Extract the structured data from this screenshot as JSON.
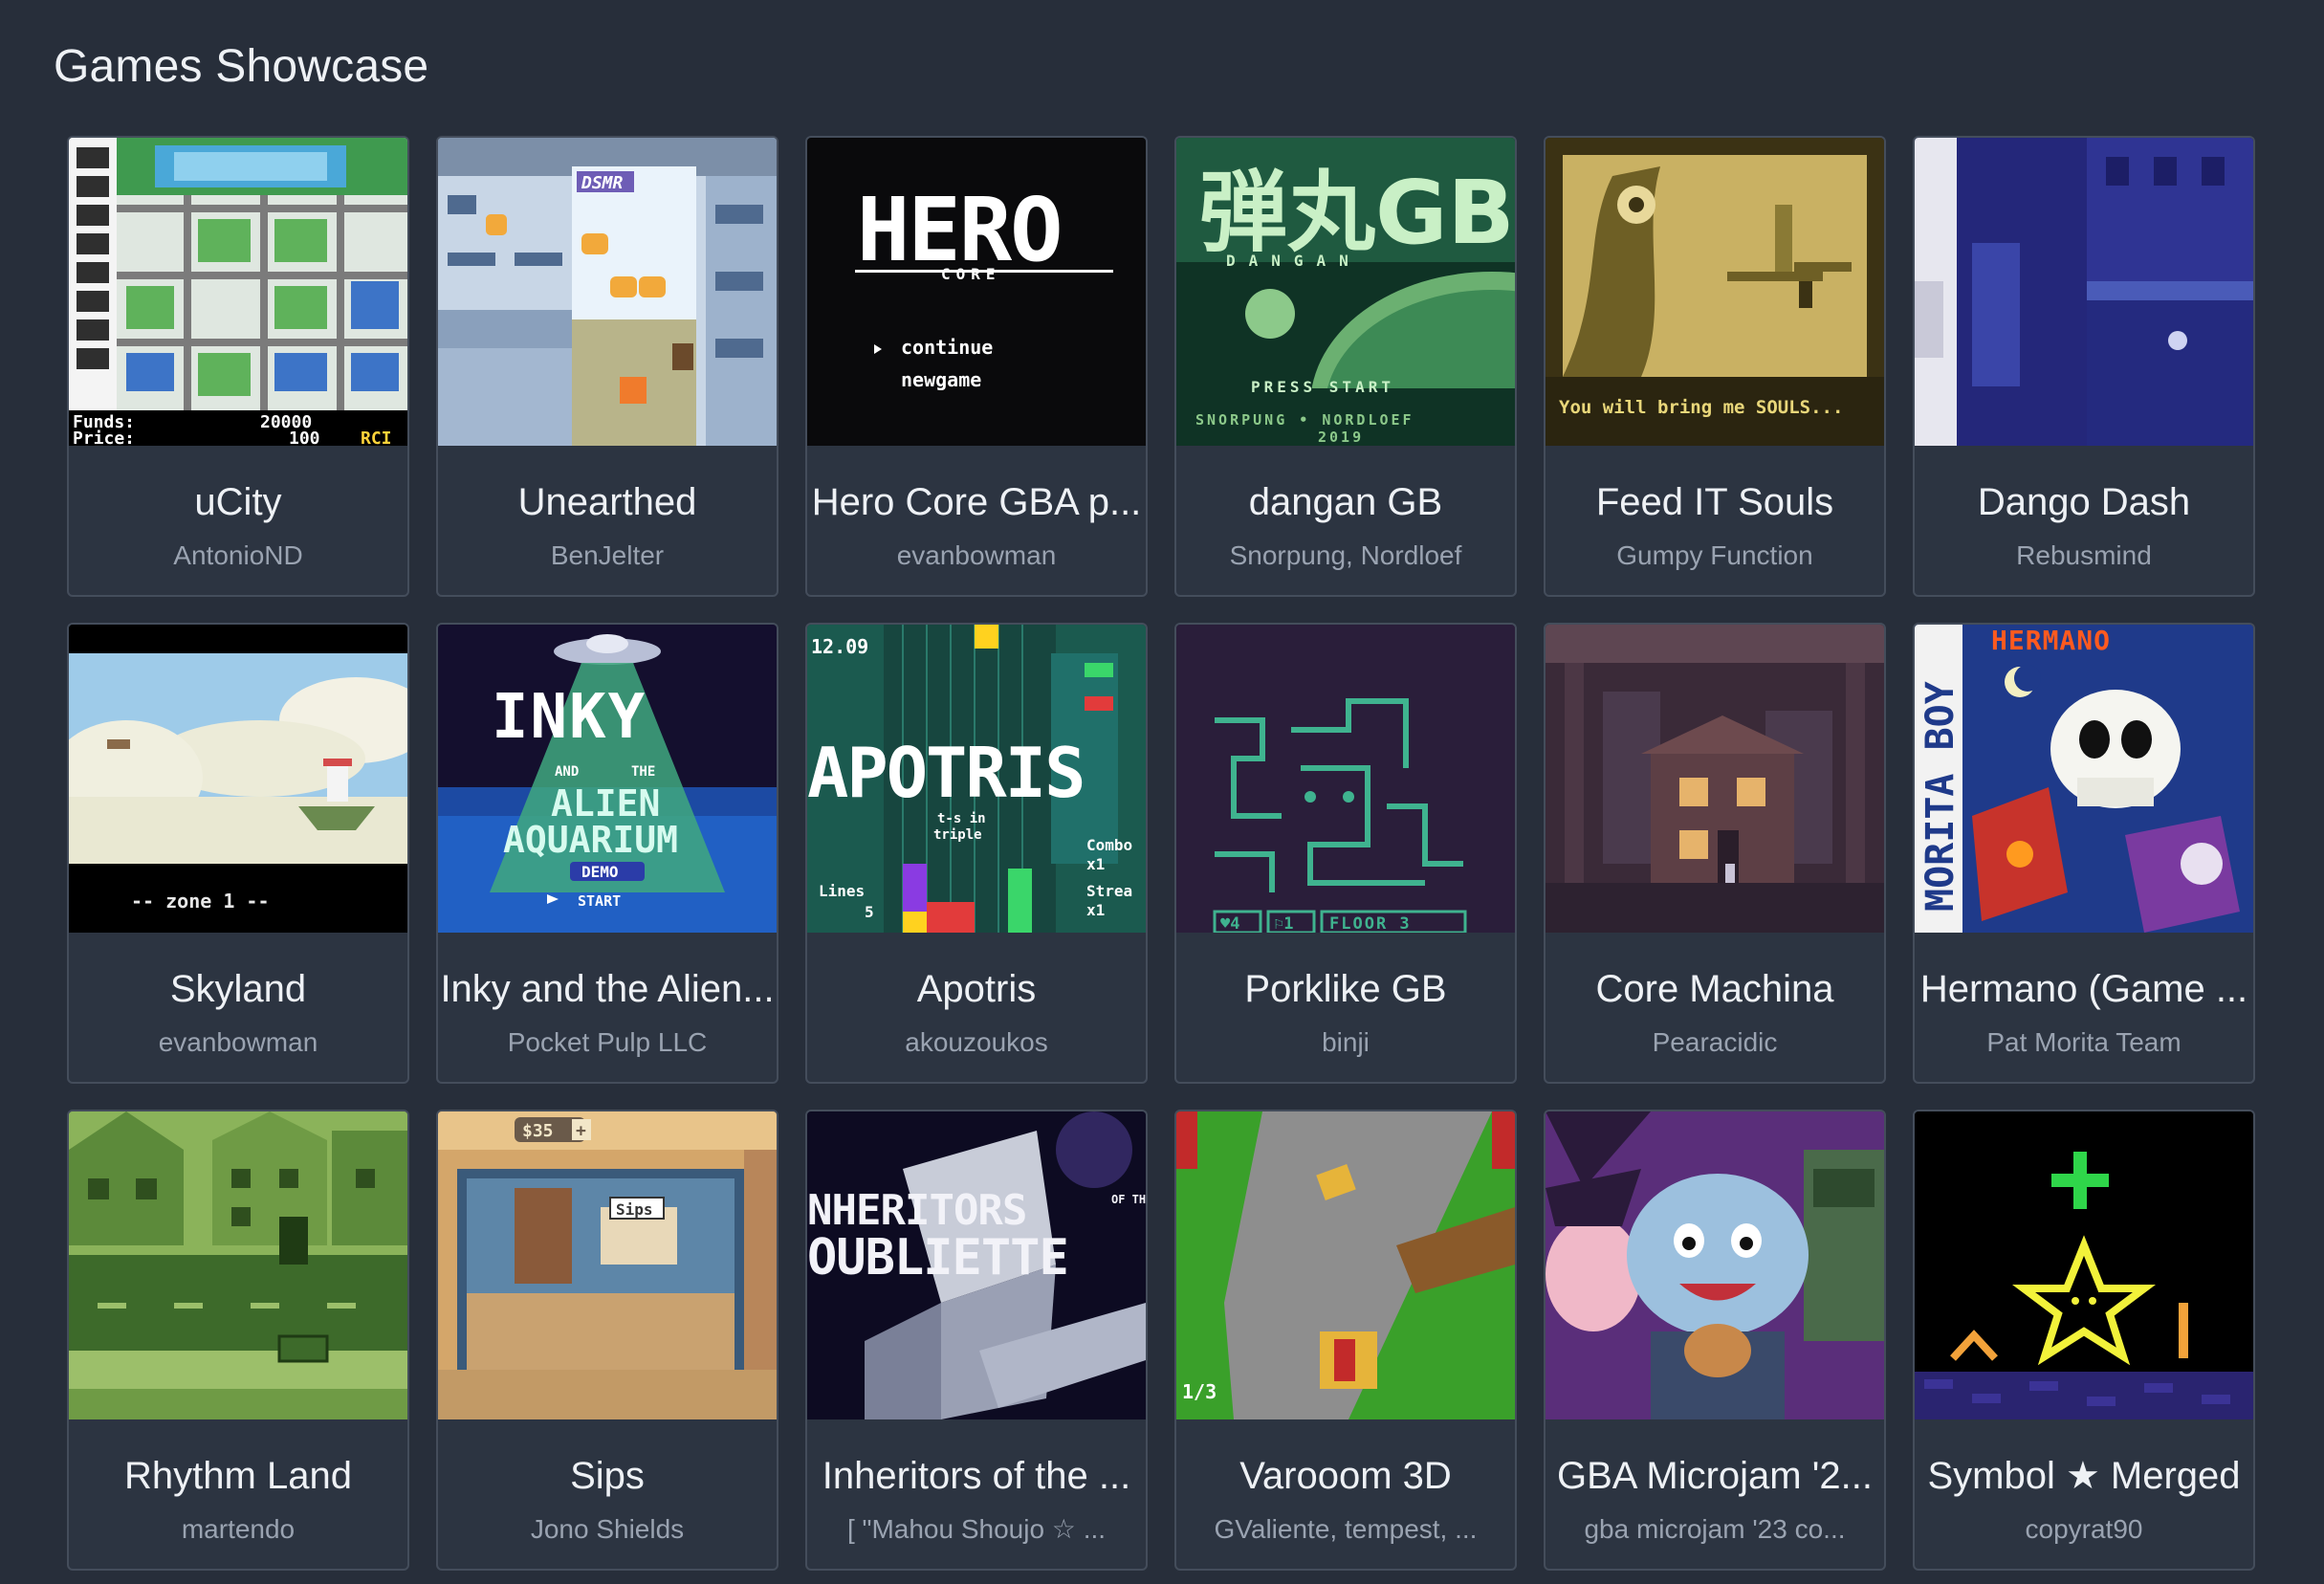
{
  "page_title": "Games Showcase",
  "games": [
    {
      "title": "uCity",
      "author": "AntonioND",
      "thumb_text": [
        "Funds:",
        "20000",
        "Price:",
        "100",
        "RCI"
      ]
    },
    {
      "title": "Unearthed",
      "author": "BenJelter",
      "thumb_text": [
        "DSMR"
      ]
    },
    {
      "title": "Hero Core GBA p...",
      "author": "evanbowman",
      "thumb_text": [
        "HERO",
        "CORE",
        "continue",
        "newgame"
      ]
    },
    {
      "title": "dangan GB",
      "author": "Snorpung, Nordloef",
      "thumb_text": [
        "弾丸GB",
        "DANGAN",
        "PRESS  START",
        "SNORPUNG • NORDLOEF",
        "2019"
      ]
    },
    {
      "title": "Feed IT Souls",
      "author": "Gumpy Function",
      "thumb_text": [
        "You will bring me SOULS..."
      ]
    },
    {
      "title": "Dango Dash",
      "author": "Rebusmind",
      "thumb_text": []
    },
    {
      "title": "Skyland",
      "author": "evanbowman",
      "thumb_text": [
        "-- zone 1 --"
      ]
    },
    {
      "title": "Inky and the Alien...",
      "author": "Pocket Pulp LLC",
      "thumb_text": [
        "INKY",
        "AND",
        "THE",
        "ALIEN",
        "AQUARIUM",
        "DEMO",
        "START"
      ]
    },
    {
      "title": "Apotris",
      "author": "akouzoukos",
      "thumb_text": [
        "12.09",
        "APOTRIS",
        "t-s in",
        "triple",
        "Lines",
        "5",
        "Combo",
        "x1",
        "Strea",
        "x1"
      ]
    },
    {
      "title": "Porklike GB",
      "author": "binji",
      "thumb_text": [
        "♥4",
        "⚐1",
        "FLOOR 3"
      ]
    },
    {
      "title": "Core Machina",
      "author": "Pearacidic",
      "thumb_text": []
    },
    {
      "title": "Hermano (Game ...",
      "author": "Pat Morita Team",
      "thumb_text": [
        "MORITA BOY",
        "HERMANO"
      ]
    },
    {
      "title": "Rhythm Land",
      "author": "martendo",
      "thumb_text": []
    },
    {
      "title": "Sips",
      "author": "Jono Shields",
      "thumb_text": [
        "$35",
        "+",
        "Sips"
      ]
    },
    {
      "title": "Inheritors of the ...",
      "author": "[ \"Mahou Shoujo ☆ ...",
      "thumb_text": [
        "NHERITORS",
        "OF THE",
        "OUBLIETTE"
      ]
    },
    {
      "title": "Varooom 3D",
      "author": "GValiente, tempest, ...",
      "thumb_text": [
        "1/3"
      ]
    },
    {
      "title": "GBA Microjam '2...",
      "author": "gba microjam '23 co...",
      "thumb_text": []
    },
    {
      "title": "Symbol ★ Merged",
      "author": "copyrat90",
      "thumb_text": []
    }
  ],
  "colors": {
    "background": "#272e3a",
    "card": "#2c3441",
    "card_border": "#444d5b",
    "title_text": "#eef1f5",
    "author_text": "#9aa3b1"
  }
}
